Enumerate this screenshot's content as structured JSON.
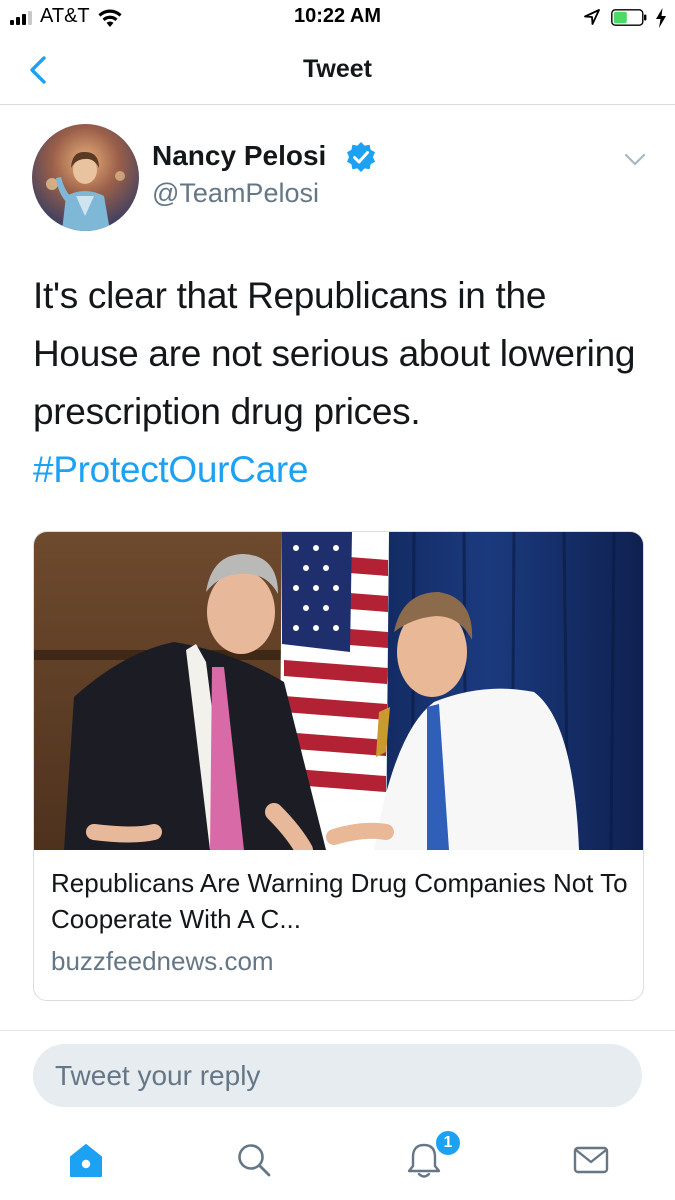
{
  "status_bar": {
    "carrier": "AT&T",
    "time": "10:22 AM",
    "icons": [
      "signal-icon",
      "wifi-icon",
      "location-icon",
      "battery-icon",
      "charging-icon"
    ]
  },
  "nav": {
    "title": "Tweet",
    "back_icon": "chevron-left-icon"
  },
  "tweet": {
    "author": {
      "name": "Nancy Pelosi",
      "handle": "@TeamPelosi",
      "verified": true
    },
    "text": "It's clear that Republicans in the House are not serious about lowering prescription drug prices.",
    "hashtag": "#ProtectOurCare",
    "card": {
      "title": "Republicans Are Warning Drug Companies Not To Cooperate With A C...",
      "domain": "buzzfeednews.com"
    }
  },
  "reply": {
    "placeholder": "Tweet your reply"
  },
  "tab_bar": {
    "tabs": [
      "home-icon",
      "search-icon",
      "notifications-icon",
      "messages-icon"
    ],
    "notifications_badge": "1"
  },
  "colors": {
    "accent": "#1da1f2",
    "text": "#14171a",
    "secondary": "#657786",
    "divider": "#e1e8ed"
  }
}
